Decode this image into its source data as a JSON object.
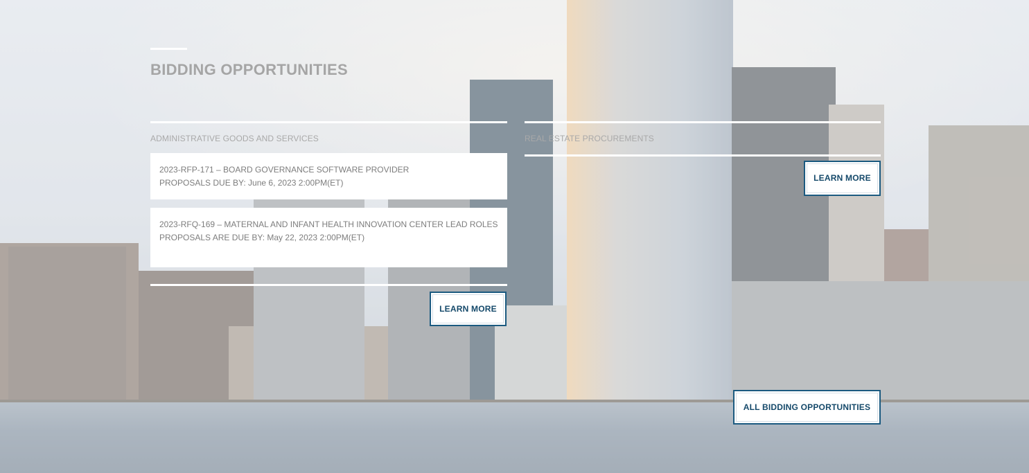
{
  "section": {
    "title": "BIDDING OPPORTUNITIES"
  },
  "columns": {
    "admin": {
      "heading": "ADMINISTRATIVE GOODS AND SERVICES",
      "items": [
        {
          "title": "2023-RFP-171 – BOARD GOVERNANCE SOFTWARE PROVIDER",
          "due": "PROPOSALS DUE BY: June 6, 2023 2:00PM(ET)"
        },
        {
          "title": "2023-RFQ-169 – MATERNAL AND INFANT HEALTH INNOVATION CENTER LEAD ROLES",
          "due": "PROPOSALS ARE DUE BY: May 22, 2023 2:00PM(ET)"
        }
      ],
      "learn_more": "LEARN MORE"
    },
    "real_estate": {
      "heading": "REAL ESTATE PROCUREMENTS",
      "learn_more": "LEARN MORE"
    }
  },
  "all_bidding_button": "ALL BIDDING OPPORTUNITIES",
  "colors": {
    "button_border": "#1b5a80",
    "button_text": "#15496a",
    "title_gray": "#a5a5a5"
  }
}
